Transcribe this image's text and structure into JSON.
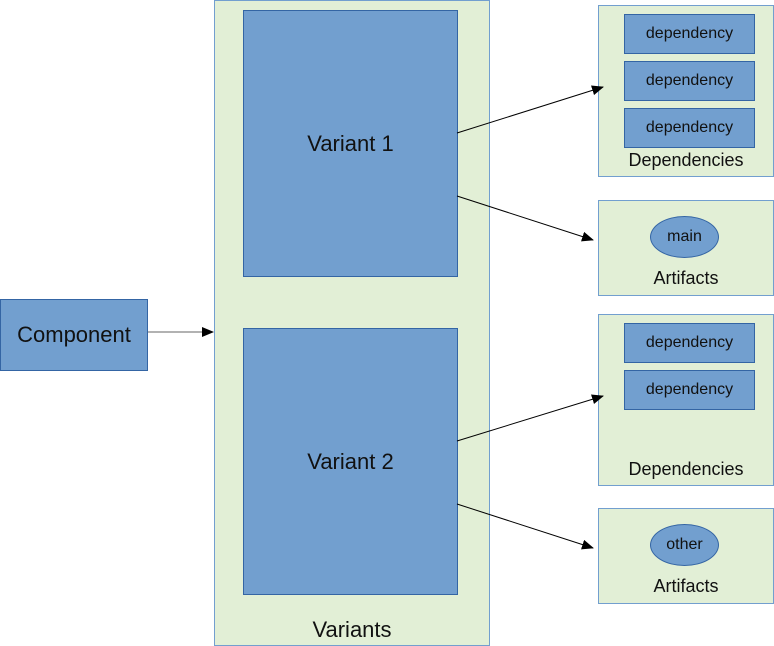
{
  "component": {
    "label": "Component"
  },
  "variants": {
    "label": "Variants",
    "items": [
      {
        "label": "Variant 1"
      },
      {
        "label": "Variant 2"
      }
    ]
  },
  "groups": [
    {
      "dependencies": {
        "label": "Dependencies",
        "items": [
          "dependency",
          "dependency",
          "dependency"
        ]
      },
      "artifacts": {
        "label": "Artifacts",
        "items": [
          "main"
        ]
      }
    },
    {
      "dependencies": {
        "label": "Dependencies",
        "items": [
          "dependency",
          "dependency"
        ]
      },
      "artifacts": {
        "label": "Artifacts",
        "items": [
          "other"
        ]
      }
    }
  ],
  "colors": {
    "node_fill": "#729fcf",
    "node_border": "#3465a4",
    "container_fill": "#e2efd6"
  }
}
